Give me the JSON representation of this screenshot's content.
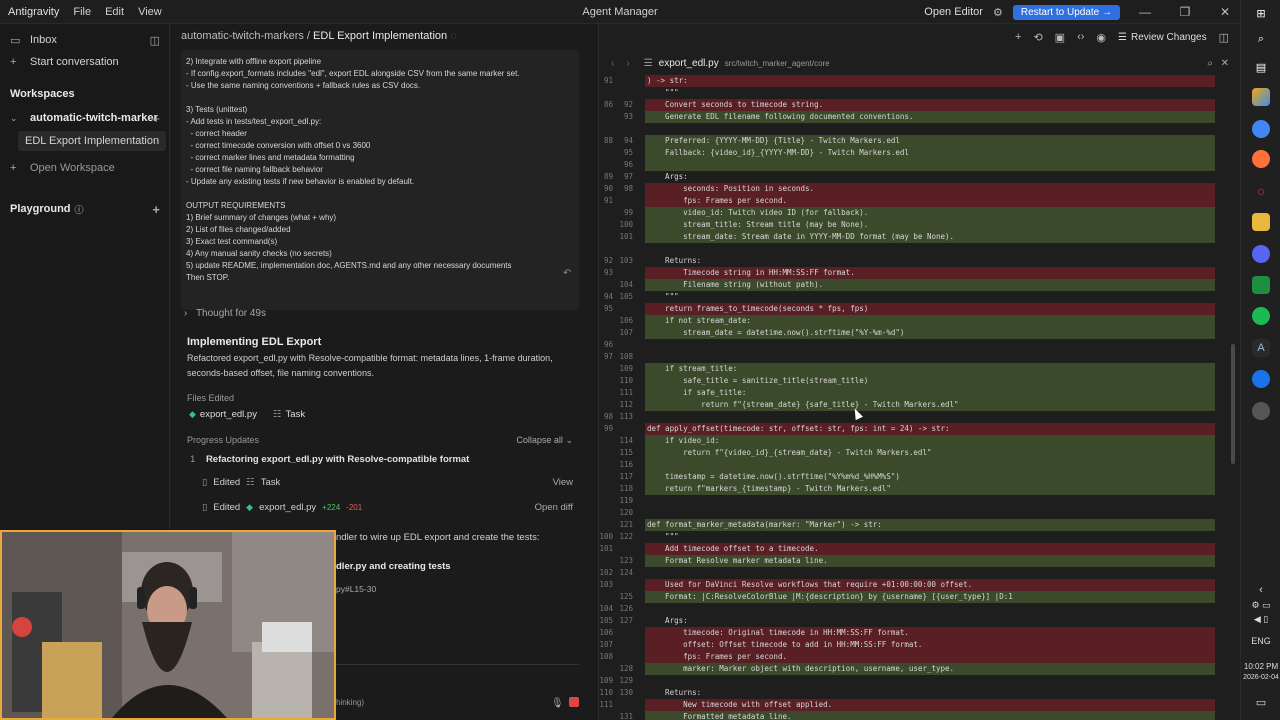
{
  "app": {
    "name": "Antigravity",
    "menu": [
      "File",
      "Edit",
      "View"
    ],
    "window_title": "Agent Manager",
    "open_editor": "Open Editor",
    "restart_label": "Restart to Update →"
  },
  "sidebar": {
    "inbox": "Inbox",
    "start_conversation": "Start conversation",
    "workspaces_header": "Workspaces",
    "workspace_name": "automatic-twitch-marker",
    "active_conversation": "EDL Export Implementation",
    "open_workspace": "Open Workspace",
    "playground": "Playground"
  },
  "chat": {
    "breadcrumb_workspace": "automatic-twitch-markers",
    "breadcrumb_sep": "/",
    "breadcrumb_title": "EDL Export Implementation",
    "prompt_lines": [
      "2) Integrate with offline export pipeline",
      "- If config.export_formats includes \"edl\", export EDL alongside CSV from the same marker set.",
      "- Use the same naming conventions + fallback rules as CSV docs.",
      "",
      "3) Tests (unittest)",
      "- Add tests in tests/test_export_edl.py:",
      "  - correct header",
      "  - correct timecode conversion with offset 0 vs 3600",
      "  - correct marker lines and metadata formatting",
      "  - correct file naming fallback behavior",
      "- Update any existing tests if new behavior is enabled by default.",
      "",
      "OUTPUT REQUIREMENTS",
      "1) Brief summary of changes (what + why)",
      "2) List of files changed/added",
      "3) Exact test command(s)",
      "4) Any manual sanity checks (no secrets)",
      "5) update README, implementation doc, AGENTS.md and any other necessary documents",
      "Then STOP."
    ],
    "thought": "Thought for 49s",
    "impl_title": "Implementing EDL Export",
    "impl_desc": "Refactored export_edl.py with Resolve-compatible format: metadata lines, 1-frame duration, seconds-based offset, file naming conventions.",
    "files_edited_label": "Files Edited",
    "file_a": "export_edl.py",
    "file_b": "Task",
    "progress_label": "Progress Updates",
    "collapse_all": "Collapse all",
    "step_num": "1",
    "step_title": "Refactoring export_edl.py with Resolve-compatible format",
    "sub1_verb": "Edited",
    "sub1_target": "Task",
    "sub1_action": "View",
    "sub2_verb": "Edited",
    "sub2_target": "export_edl.py",
    "sub2_plus": "+224",
    "sub2_minus": "-201",
    "sub2_action": "Open diff",
    "frag1": "ndler to wire up EDL export and create the tests:",
    "frag2": "dler.py and creating tests",
    "frag3": "py#L15-30",
    "frag4": "hinking)"
  },
  "editor": {
    "filename": "export_edl.py",
    "path": "src/twitch_marker_agent/core",
    "review_changes": "Review Changes",
    "lines": [
      {
        "a": "91",
        "b": "",
        "t": ") -> str:",
        "k": "del"
      },
      {
        "a": "",
        "b": "",
        "t": "    \"\"\"",
        "k": "ctx"
      },
      {
        "a": "86",
        "b": "92",
        "t": "    Convert seconds to timecode string.",
        "k": "del"
      },
      {
        "a": "",
        "b": "93",
        "t": "    Generate EDL filename following documented conventions.",
        "k": "add"
      },
      {
        "a": "",
        "b": "",
        "t": "",
        "k": "ctx"
      },
      {
        "a": "88",
        "b": "94",
        "t": "    Preferred: {YYYY-MM-DD} {Title} - Twitch Markers.edl",
        "k": "add"
      },
      {
        "a": "",
        "b": "95",
        "t": "    Fallback: {video_id}_{YYYY-MM-DD} - Twitch Markers.edl",
        "k": "add"
      },
      {
        "a": "",
        "b": "96",
        "t": "",
        "k": "add"
      },
      {
        "a": "89",
        "b": "97",
        "t": "    Args:",
        "k": "ctx"
      },
      {
        "a": "90",
        "b": "98",
        "t": "        seconds: Position in seconds.",
        "k": "del"
      },
      {
        "a": "91",
        "b": "",
        "t": "        fps: Frames per second.",
        "k": "del"
      },
      {
        "a": "",
        "b": "99",
        "t": "        video_id: Twitch video ID (for fallback).",
        "k": "add"
      },
      {
        "a": "",
        "b": "100",
        "t": "        stream_title: Stream title (may be None).",
        "k": "add"
      },
      {
        "a": "",
        "b": "101",
        "t": "        stream_date: Stream date in YYYY-MM-DD format (may be None).",
        "k": "add"
      },
      {
        "a": "",
        "b": "",
        "t": "",
        "k": "ctx"
      },
      {
        "a": "92",
        "b": "103",
        "t": "    Returns:",
        "k": "ctx"
      },
      {
        "a": "93",
        "b": "",
        "t": "        Timecode string in HH:MM:SS:FF format.",
        "k": "del"
      },
      {
        "a": "",
        "b": "104",
        "t": "        Filename string (without path).",
        "k": "add"
      },
      {
        "a": "94",
        "b": "105",
        "t": "    \"\"\"",
        "k": "ctx"
      },
      {
        "a": "95",
        "b": "",
        "t": "    return frames_to_timecode(seconds * fps, fps)",
        "k": "del"
      },
      {
        "a": "",
        "b": "106",
        "t": "    if not stream_date:",
        "k": "add"
      },
      {
        "a": "",
        "b": "107",
        "t": "        stream_date = datetime.now().strftime(\"%Y-%m-%d\")",
        "k": "add"
      },
      {
        "a": "96",
        "b": "",
        "t": "",
        "k": "ctx"
      },
      {
        "a": "97",
        "b": "108",
        "t": "",
        "k": "ctx"
      },
      {
        "a": "",
        "b": "109",
        "t": "    if stream_title:",
        "k": "add"
      },
      {
        "a": "",
        "b": "110",
        "t": "        safe_title = sanitize_title(stream_title)",
        "k": "add"
      },
      {
        "a": "",
        "b": "111",
        "t": "        if safe_title:",
        "k": "add"
      },
      {
        "a": "",
        "b": "112",
        "t": "            return f\"{stream_date} {safe_title} - Twitch Markers.edl\"",
        "k": "add"
      },
      {
        "a": "98",
        "b": "113",
        "t": "",
        "k": "ctx"
      },
      {
        "a": "99",
        "b": "",
        "t": "def apply_offset(timecode: str, offset: str, fps: int = 24) -> str:",
        "k": "del"
      },
      {
        "a": "",
        "b": "114",
        "t": "    if video_id:",
        "k": "add"
      },
      {
        "a": "",
        "b": "115",
        "t": "        return f\"{video_id}_{stream_date} - Twitch Markers.edl\"",
        "k": "add"
      },
      {
        "a": "",
        "b": "116",
        "t": "",
        "k": "add"
      },
      {
        "a": "",
        "b": "117",
        "t": "    timestamp = datetime.now().strftime(\"%Y%m%d_%H%M%S\")",
        "k": "add"
      },
      {
        "a": "",
        "b": "118",
        "t": "    return f\"markers_{timestamp} - Twitch Markers.edl\"",
        "k": "add"
      },
      {
        "a": "",
        "b": "119",
        "t": "",
        "k": "ctx"
      },
      {
        "a": "",
        "b": "120",
        "t": "",
        "k": "ctx"
      },
      {
        "a": "",
        "b": "121",
        "t": "def format_marker_metadata(marker: \"Marker\") -> str:",
        "k": "add"
      },
      {
        "a": "100",
        "b": "122",
        "t": "    \"\"\"",
        "k": "ctx"
      },
      {
        "a": "101",
        "b": "",
        "t": "    Add timecode offset to a timecode.",
        "k": "del"
      },
      {
        "a": "",
        "b": "123",
        "t": "    Format Resolve marker metadata line.",
        "k": "add"
      },
      {
        "a": "102",
        "b": "124",
        "t": "",
        "k": "ctx"
      },
      {
        "a": "103",
        "b": "",
        "t": "    Used for DaVinci Resolve workflows that require +01:00:00:00 offset.",
        "k": "del"
      },
      {
        "a": "",
        "b": "125",
        "t": "    Format: |C:ResolveColorBlue |M:{description} by {username} [{user_type}] |D:1",
        "k": "add"
      },
      {
        "a": "104",
        "b": "126",
        "t": "",
        "k": "ctx"
      },
      {
        "a": "105",
        "b": "127",
        "t": "    Args:",
        "k": "ctx"
      },
      {
        "a": "106",
        "b": "",
        "t": "        timecode: Original timecode in HH:MM:SS:FF format.",
        "k": "del"
      },
      {
        "a": "107",
        "b": "",
        "t": "        offset: Offset timecode to add in HH:MM:SS:FF format.",
        "k": "del"
      },
      {
        "a": "108",
        "b": "",
        "t": "        fps: Frames per second.",
        "k": "del"
      },
      {
        "a": "",
        "b": "128",
        "t": "        marker: Marker object with description, username, user_type.",
        "k": "add"
      },
      {
        "a": "109",
        "b": "129",
        "t": "",
        "k": "ctx"
      },
      {
        "a": "110",
        "b": "130",
        "t": "    Returns:",
        "k": "ctx"
      },
      {
        "a": "111",
        "b": "",
        "t": "        New timecode with offset applied.",
        "k": "del"
      },
      {
        "a": "",
        "b": "131",
        "t": "        Formatted metadata line.",
        "k": "add"
      },
      {
        "a": "112",
        "b": "132",
        "t": "    \"\"\"",
        "k": "ctx"
      }
    ]
  },
  "taskbar": {
    "lang": "ENG",
    "time": "10:02 PM",
    "date": "2026-02-04"
  },
  "colors": {
    "accent": "#2f6fe0",
    "diff_del": "#5a1f25",
    "diff_add": "#3b4a2a",
    "webcam_border": "#e8a93a"
  }
}
